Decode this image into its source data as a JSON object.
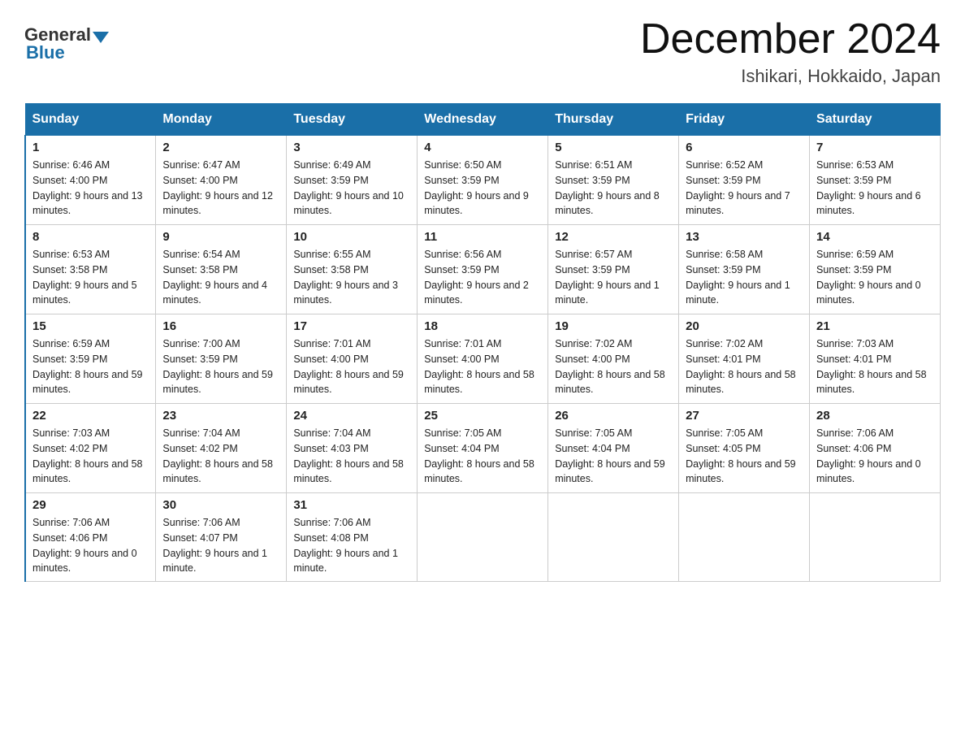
{
  "logo": {
    "general": "General",
    "blue": "Blue"
  },
  "title": "December 2024",
  "subtitle": "Ishikari, Hokkaido, Japan",
  "days_of_week": [
    "Sunday",
    "Monday",
    "Tuesday",
    "Wednesday",
    "Thursday",
    "Friday",
    "Saturday"
  ],
  "weeks": [
    [
      {
        "day": "1",
        "sunrise": "Sunrise: 6:46 AM",
        "sunset": "Sunset: 4:00 PM",
        "daylight": "Daylight: 9 hours and 13 minutes."
      },
      {
        "day": "2",
        "sunrise": "Sunrise: 6:47 AM",
        "sunset": "Sunset: 4:00 PM",
        "daylight": "Daylight: 9 hours and 12 minutes."
      },
      {
        "day": "3",
        "sunrise": "Sunrise: 6:49 AM",
        "sunset": "Sunset: 3:59 PM",
        "daylight": "Daylight: 9 hours and 10 minutes."
      },
      {
        "day": "4",
        "sunrise": "Sunrise: 6:50 AM",
        "sunset": "Sunset: 3:59 PM",
        "daylight": "Daylight: 9 hours and 9 minutes."
      },
      {
        "day": "5",
        "sunrise": "Sunrise: 6:51 AM",
        "sunset": "Sunset: 3:59 PM",
        "daylight": "Daylight: 9 hours and 8 minutes."
      },
      {
        "day": "6",
        "sunrise": "Sunrise: 6:52 AM",
        "sunset": "Sunset: 3:59 PM",
        "daylight": "Daylight: 9 hours and 7 minutes."
      },
      {
        "day": "7",
        "sunrise": "Sunrise: 6:53 AM",
        "sunset": "Sunset: 3:59 PM",
        "daylight": "Daylight: 9 hours and 6 minutes."
      }
    ],
    [
      {
        "day": "8",
        "sunrise": "Sunrise: 6:53 AM",
        "sunset": "Sunset: 3:58 PM",
        "daylight": "Daylight: 9 hours and 5 minutes."
      },
      {
        "day": "9",
        "sunrise": "Sunrise: 6:54 AM",
        "sunset": "Sunset: 3:58 PM",
        "daylight": "Daylight: 9 hours and 4 minutes."
      },
      {
        "day": "10",
        "sunrise": "Sunrise: 6:55 AM",
        "sunset": "Sunset: 3:58 PM",
        "daylight": "Daylight: 9 hours and 3 minutes."
      },
      {
        "day": "11",
        "sunrise": "Sunrise: 6:56 AM",
        "sunset": "Sunset: 3:59 PM",
        "daylight": "Daylight: 9 hours and 2 minutes."
      },
      {
        "day": "12",
        "sunrise": "Sunrise: 6:57 AM",
        "sunset": "Sunset: 3:59 PM",
        "daylight": "Daylight: 9 hours and 1 minute."
      },
      {
        "day": "13",
        "sunrise": "Sunrise: 6:58 AM",
        "sunset": "Sunset: 3:59 PM",
        "daylight": "Daylight: 9 hours and 1 minute."
      },
      {
        "day": "14",
        "sunrise": "Sunrise: 6:59 AM",
        "sunset": "Sunset: 3:59 PM",
        "daylight": "Daylight: 9 hours and 0 minutes."
      }
    ],
    [
      {
        "day": "15",
        "sunrise": "Sunrise: 6:59 AM",
        "sunset": "Sunset: 3:59 PM",
        "daylight": "Daylight: 8 hours and 59 minutes."
      },
      {
        "day": "16",
        "sunrise": "Sunrise: 7:00 AM",
        "sunset": "Sunset: 3:59 PM",
        "daylight": "Daylight: 8 hours and 59 minutes."
      },
      {
        "day": "17",
        "sunrise": "Sunrise: 7:01 AM",
        "sunset": "Sunset: 4:00 PM",
        "daylight": "Daylight: 8 hours and 59 minutes."
      },
      {
        "day": "18",
        "sunrise": "Sunrise: 7:01 AM",
        "sunset": "Sunset: 4:00 PM",
        "daylight": "Daylight: 8 hours and 58 minutes."
      },
      {
        "day": "19",
        "sunrise": "Sunrise: 7:02 AM",
        "sunset": "Sunset: 4:00 PM",
        "daylight": "Daylight: 8 hours and 58 minutes."
      },
      {
        "day": "20",
        "sunrise": "Sunrise: 7:02 AM",
        "sunset": "Sunset: 4:01 PM",
        "daylight": "Daylight: 8 hours and 58 minutes."
      },
      {
        "day": "21",
        "sunrise": "Sunrise: 7:03 AM",
        "sunset": "Sunset: 4:01 PM",
        "daylight": "Daylight: 8 hours and 58 minutes."
      }
    ],
    [
      {
        "day": "22",
        "sunrise": "Sunrise: 7:03 AM",
        "sunset": "Sunset: 4:02 PM",
        "daylight": "Daylight: 8 hours and 58 minutes."
      },
      {
        "day": "23",
        "sunrise": "Sunrise: 7:04 AM",
        "sunset": "Sunset: 4:02 PM",
        "daylight": "Daylight: 8 hours and 58 minutes."
      },
      {
        "day": "24",
        "sunrise": "Sunrise: 7:04 AM",
        "sunset": "Sunset: 4:03 PM",
        "daylight": "Daylight: 8 hours and 58 minutes."
      },
      {
        "day": "25",
        "sunrise": "Sunrise: 7:05 AM",
        "sunset": "Sunset: 4:04 PM",
        "daylight": "Daylight: 8 hours and 58 minutes."
      },
      {
        "day": "26",
        "sunrise": "Sunrise: 7:05 AM",
        "sunset": "Sunset: 4:04 PM",
        "daylight": "Daylight: 8 hours and 59 minutes."
      },
      {
        "day": "27",
        "sunrise": "Sunrise: 7:05 AM",
        "sunset": "Sunset: 4:05 PM",
        "daylight": "Daylight: 8 hours and 59 minutes."
      },
      {
        "day": "28",
        "sunrise": "Sunrise: 7:06 AM",
        "sunset": "Sunset: 4:06 PM",
        "daylight": "Daylight: 9 hours and 0 minutes."
      }
    ],
    [
      {
        "day": "29",
        "sunrise": "Sunrise: 7:06 AM",
        "sunset": "Sunset: 4:06 PM",
        "daylight": "Daylight: 9 hours and 0 minutes."
      },
      {
        "day": "30",
        "sunrise": "Sunrise: 7:06 AM",
        "sunset": "Sunset: 4:07 PM",
        "daylight": "Daylight: 9 hours and 1 minute."
      },
      {
        "day": "31",
        "sunrise": "Sunrise: 7:06 AM",
        "sunset": "Sunset: 4:08 PM",
        "daylight": "Daylight: 9 hours and 1 minute."
      },
      null,
      null,
      null,
      null
    ]
  ]
}
